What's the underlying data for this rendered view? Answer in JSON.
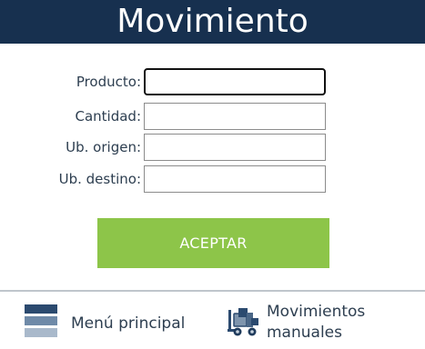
{
  "header": {
    "title": "Movimiento"
  },
  "form": {
    "product_label": "Producto:",
    "product_value": "",
    "quantity_label": "Cantidad:",
    "quantity_value": "",
    "origin_label": "Ub. origen:",
    "origin_value": "",
    "destination_label": "Ub. destino:",
    "destination_value": "",
    "accept_label": "ACEPTAR"
  },
  "footer": {
    "menu_label": "Menú principal",
    "manual_label_line1": "Movimientos",
    "manual_label_line2": "manuales",
    "menu_icon": "hamburger-icon",
    "manual_icon": "forklift-icon"
  },
  "colors": {
    "header_bg": "#17304f",
    "accept_bg": "#8dc549",
    "text": "#2d3e50"
  }
}
